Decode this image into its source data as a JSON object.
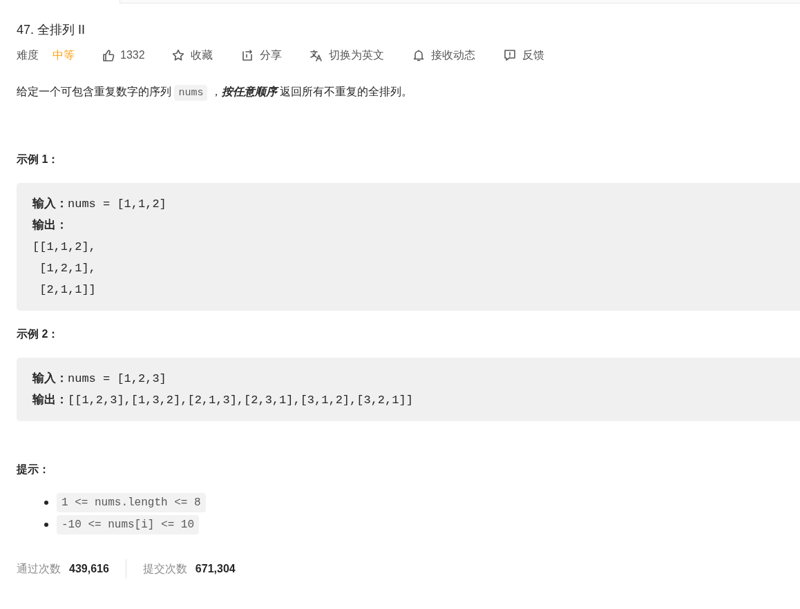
{
  "title": "47. 全排列 II",
  "meta": {
    "difficulty_label": "难度",
    "difficulty": "中等",
    "likes": "1332"
  },
  "actions": [
    {
      "kind": "star",
      "label": "收藏"
    },
    {
      "kind": "share",
      "label": "分享"
    },
    {
      "kind": "translate",
      "label": "切换为英文"
    },
    {
      "kind": "bell",
      "label": "接收动态"
    },
    {
      "kind": "feedback",
      "label": "反馈"
    }
  ],
  "description": [
    {
      "kind": "text",
      "text": "给定一个可包含重复数字的序列 "
    },
    {
      "kind": "code",
      "text": "nums"
    },
    {
      "kind": "text",
      "text": " ，"
    },
    {
      "kind": "emphasis",
      "text": "按任意顺序"
    },
    {
      "kind": "text",
      "text": " 返回所有不重复的全排列。"
    }
  ],
  "examples": [
    {
      "heading": "示例 1：",
      "lines": [
        "**输入：**nums = [1,1,2]",
        "**输出：**",
        "[[1,1,2],",
        " [1,2,1],",
        " [2,1,1]]"
      ]
    },
    {
      "heading": "示例 2：",
      "lines": [
        "**输入：**nums = [1,2,3]",
        "**输出：**[[1,2,3],[1,3,2],[2,1,3],[2,3,1],[3,1,2],[3,2,1]]"
      ]
    }
  ],
  "hints": {
    "heading": "提示：",
    "items": [
      "1 <= nums.length <= 8",
      "-10 <= nums[i] <= 10"
    ]
  },
  "stats": [
    {
      "label": "通过次数",
      "value": "439,616"
    },
    {
      "label": "提交次数",
      "value": "671,304"
    }
  ]
}
